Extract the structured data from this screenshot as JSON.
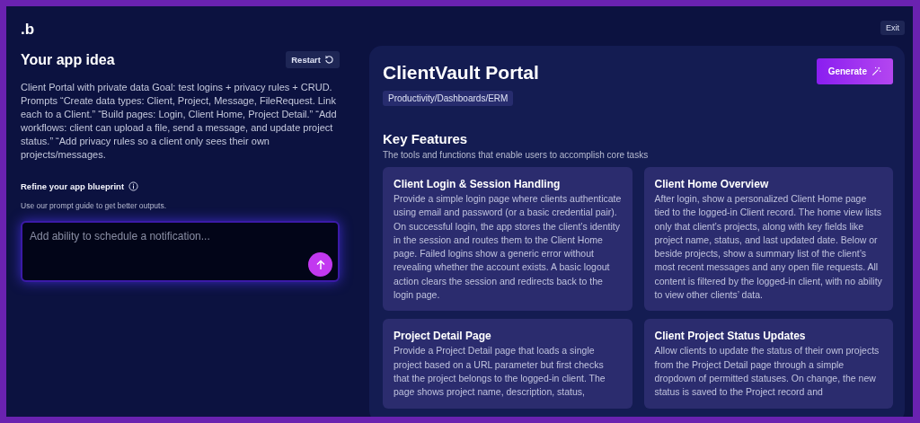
{
  "logo": ".b",
  "exit_button": "Exit",
  "idea": {
    "title": "Your app idea",
    "restart_button": "Restart",
    "description": "Client Portal with private data Goal: test logins + privacy rules + CRUD. Prompts “Create data types: Client, Project, Message, FileRequest. Link each to a Client.” “Build pages: Login, Client Home, Project Detail.” “Add workflows: client can upload a file, send a message, and update project status.” “Add privacy rules so a client only sees their own projects/messages."
  },
  "refine": {
    "title": "Refine your app blueprint",
    "hint": "Use our prompt guide to get better outputs.",
    "placeholder": "Add ability to schedule a notification..."
  },
  "app": {
    "title": "ClientVault Portal",
    "category": "Productivity/Dashboards/ERM",
    "generate_button": "Generate"
  },
  "features": {
    "title": "Key Features",
    "subtitle": "The tools and functions that enable users to accomplish core tasks",
    "items": [
      {
        "title": "Client Login & Session Handling",
        "body": "Provide a simple login page where clients authenticate using email and password (or a basic credential pair). On successful login, the app stores the client’s identity in the session and routes them to the Client Home page. Failed logins show a generic error without revealing whether the account exists. A basic logout action clears the session and redirects back to the login page."
      },
      {
        "title": "Client Home Overview",
        "body": "After login, show a personalized Client Home page tied to the logged-in Client record. The home view lists only that client’s projects, along with key fields like project name, status, and last updated date. Below or beside projects, show a summary list of the client’s most recent messages and any open file requests. All content is filtered by the logged-in client, with no ability to view other clients’ data."
      },
      {
        "title": "Project Detail Page",
        "body": "Provide a Project Detail page that loads a single project based on a URL parameter but first checks that the project belongs to the logged-in client. The page shows project name, description, status,"
      },
      {
        "title": "Client Project Status Updates",
        "body": "Allow clients to update the status of their own projects from the Project Detail page through a simple dropdown of permitted statuses. On change, the new status is saved to the Project record and"
      }
    ]
  }
}
